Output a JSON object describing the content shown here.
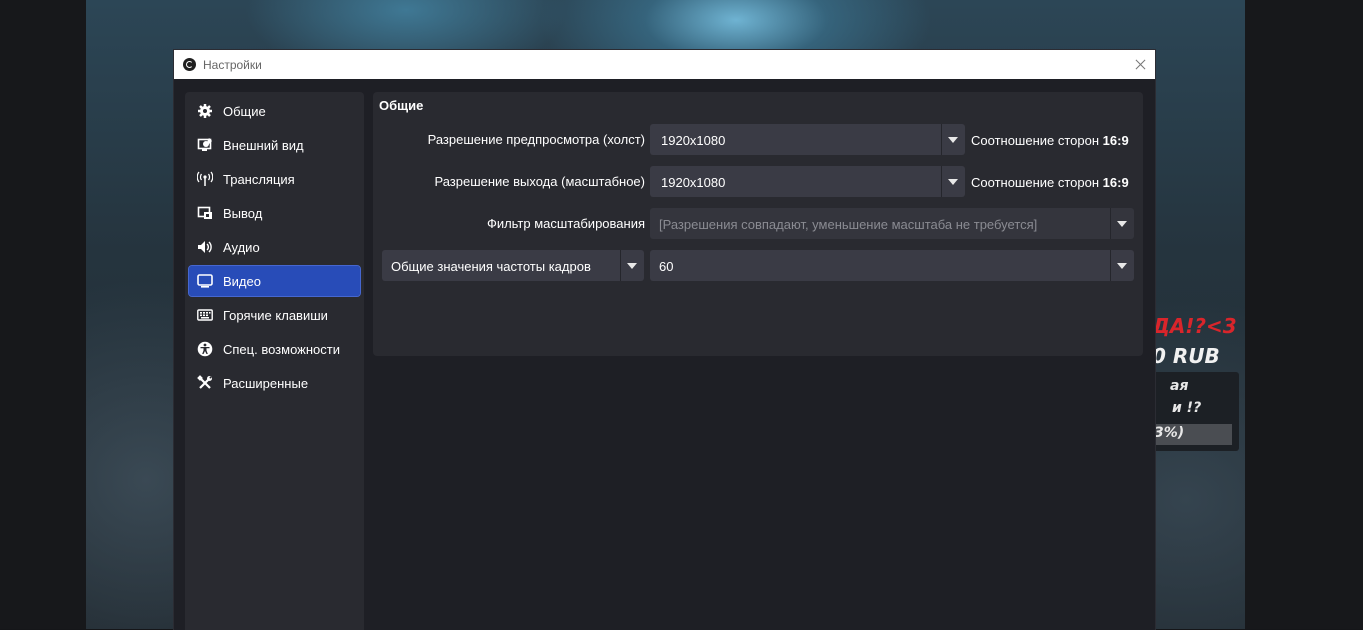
{
  "background": {
    "overlay_line1": "ДА!?<3",
    "overlay_line2": "0 RUB",
    "panel_line1": "ая",
    "panel_line2": "и !?",
    "panel_line3": "3%)"
  },
  "window": {
    "title": "Настройки"
  },
  "sidebar": {
    "items": [
      {
        "label": "Общие",
        "icon": "gear-icon"
      },
      {
        "label": "Внешний вид",
        "icon": "appearance-icon"
      },
      {
        "label": "Трансляция",
        "icon": "broadcast-icon"
      },
      {
        "label": "Вывод",
        "icon": "output-icon"
      },
      {
        "label": "Аудио",
        "icon": "speaker-icon"
      },
      {
        "label": "Видео",
        "icon": "monitor-icon",
        "active": true
      },
      {
        "label": "Горячие клавиши",
        "icon": "keyboard-icon"
      },
      {
        "label": "Спец. возможности",
        "icon": "accessibility-icon"
      },
      {
        "label": "Расширенные",
        "icon": "tools-icon"
      }
    ]
  },
  "main": {
    "group_title": "Общие",
    "base_resolution": {
      "label": "Разрешение предпросмотра (холст)",
      "value": "1920x1080",
      "aspect_label": "Соотношение сторон",
      "aspect_value": "16:9"
    },
    "output_resolution": {
      "label": "Разрешение выхода (масштабное)",
      "value": "1920x1080",
      "aspect_label": "Соотношение сторон",
      "aspect_value": "16:9"
    },
    "downscale_filter": {
      "label": "Фильтр масштабирования",
      "value": "[Разрешения совпадают, уменьшение масштаба не требуется]"
    },
    "fps": {
      "type_value": "Общие значения частоты кадров",
      "value": "60"
    }
  },
  "colors": {
    "accent": "#284cb8",
    "window_bg": "#1e1f25",
    "panel_bg": "#292a30",
    "input_bg": "#3a3b45"
  }
}
